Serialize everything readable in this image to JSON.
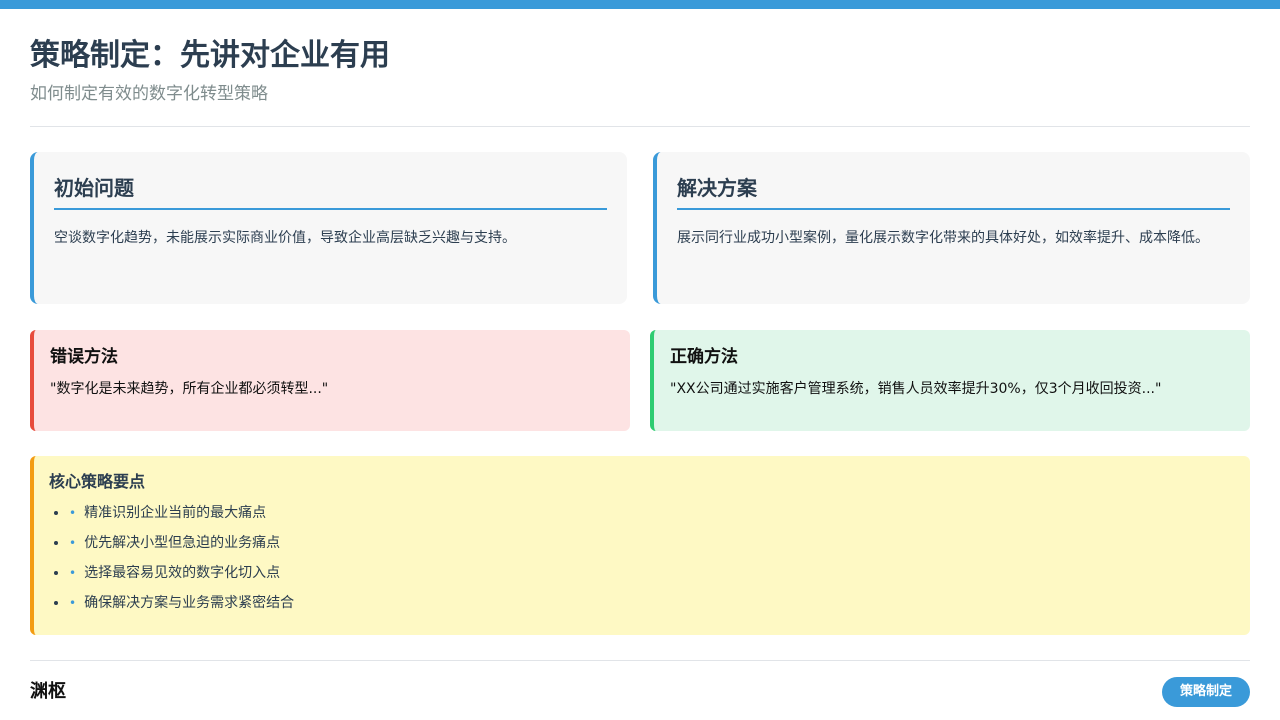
{
  "header": {
    "title": "策略制定：先讲对企业有用",
    "subtitle": "如何制定有效的数字化转型策略"
  },
  "cards": [
    {
      "title": "初始问题",
      "text": "空谈数字化趋势，未能展示实际商业价值，导致企业高层缺乏兴趣与支持。"
    },
    {
      "title": "解决方案",
      "text": "展示同行业成功小型案例，量化展示数字化带来的具体好处，如效率提升、成本降低。"
    }
  ],
  "compare": {
    "wrong": {
      "title": "错误方法",
      "text": "\"数字化是未来趋势，所有企业都必须转型...\""
    },
    "right": {
      "title": "正确方法",
      "text": "\"XX公司通过实施客户管理系统，销售人员效率提升30%，仅3个月收回投资...\""
    }
  },
  "keypoints": {
    "title": "核心策略要点",
    "items": [
      "精准识别企业当前的最大痛点",
      "优先解决小型但急迫的业务痛点",
      "选择最容易见效的数字化切入点",
      "确保解决方案与业务需求紧密结合"
    ],
    "bullet": "•"
  },
  "footer": {
    "brand": "渊枢",
    "badge": "策略制定"
  },
  "colors": {
    "accent": "#3a9ad9",
    "wrong": "#e74c3c",
    "right": "#2ecc71",
    "highlight": "#f39c12"
  }
}
